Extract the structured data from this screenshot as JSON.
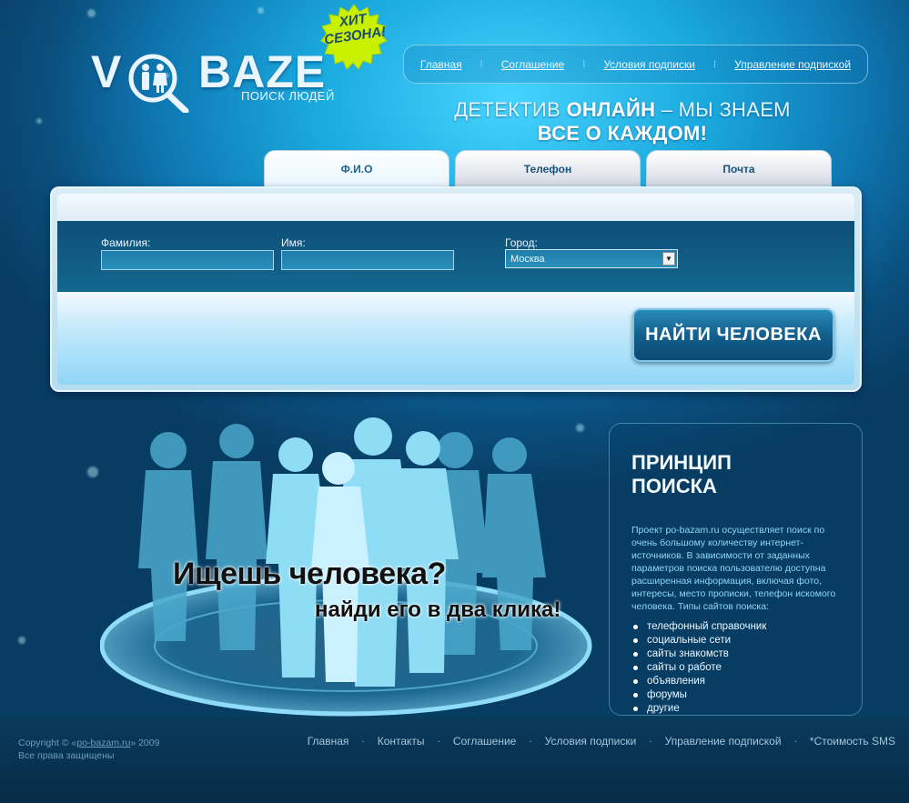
{
  "logo": {
    "left_letter": "V",
    "brand": "BAZE",
    "subtitle": "ПОИСК ЛЮДЕЙ",
    "badge_line1": "ХИТ",
    "badge_line2": "СЕЗОНА!"
  },
  "topnav": {
    "items": [
      {
        "label": "Главная"
      },
      {
        "label": "Соглашение"
      },
      {
        "label": "Условия подписки"
      },
      {
        "label": "Управление подпиской"
      }
    ]
  },
  "tagline": {
    "part1": "ДЕТЕКТИВ ",
    "part2": "ОНЛАЙН",
    "part3": " – МЫ ЗНАЕМ ",
    "part4": "ВСЕ О КАЖДОМ!"
  },
  "tabs": [
    {
      "label": "Ф.И.О",
      "active": true
    },
    {
      "label": "Телефон",
      "active": false
    },
    {
      "label": "Почта",
      "active": false
    }
  ],
  "search": {
    "surname_label": "Фамилия:",
    "surname_value": "",
    "name_label": "Имя:",
    "name_value": "",
    "city_label": "Город:",
    "city_value": "Москва",
    "button_label": "НАЙТИ ЧЕЛОВЕКА"
  },
  "promo": {
    "slogan1": "Ищешь человека?",
    "slogan2": "найди его в два клика!"
  },
  "info": {
    "title_line1": "ПРИНЦИП",
    "title_line2": "ПОИСКА",
    "text": "Проект po-bazam.ru осуществляет поиск по очень большому количеству интернет-источников. В зависимости от заданных параметров поиска пользователю доступна расширенная информация, включая фото, интересы, место прописки, телефон искомого человека. Типы сайтов поиска:",
    "list": [
      "телефонный справочник",
      "социальные сети",
      "сайты знакомств",
      "сайты о работе",
      "объявления",
      "форумы",
      "другие"
    ]
  },
  "footer": {
    "copyright_prefix": "Copyright © «",
    "copyright_link": "po-bazam.ru",
    "copyright_suffix": "» 2009",
    "rights": "Все права защищены",
    "nav": [
      {
        "label": "Главная"
      },
      {
        "label": "Контакты"
      },
      {
        "label": "Соглашение"
      },
      {
        "label": "Условия подписки"
      },
      {
        "label": "Управление подпиской"
      },
      {
        "label": "*Стоимость SMS"
      }
    ]
  },
  "colors": {
    "background": "#1aa9de",
    "panel_band": "#0e4f78",
    "button": "#135f8d",
    "footer": "#0a3a5c",
    "badge": "#c8f000"
  }
}
